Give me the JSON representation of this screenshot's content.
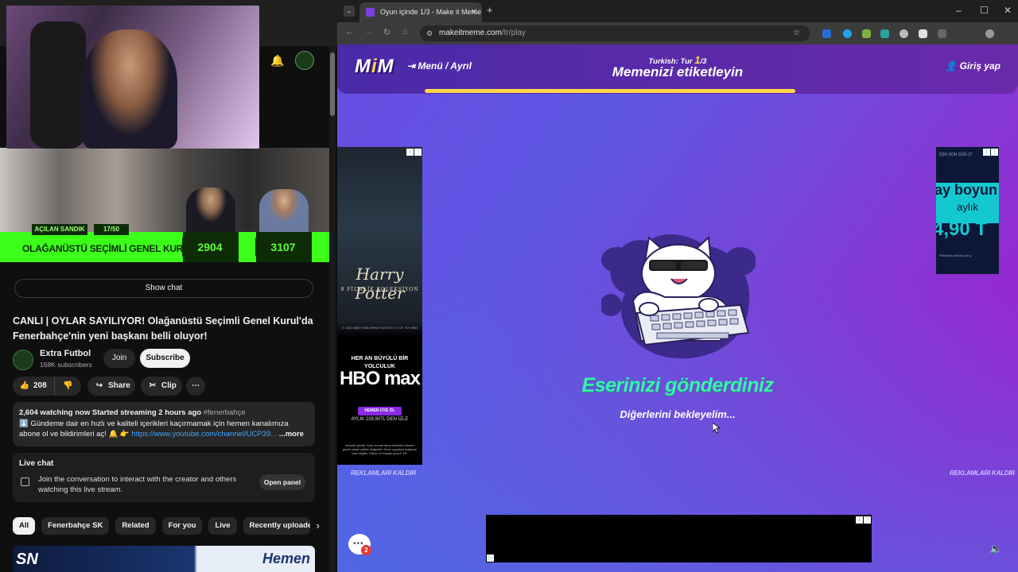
{
  "youtube": {
    "show_chat_label": "Show chat",
    "video_title": "CANLI | OYLAR SAYILIYOR! Olağanüstü Seçimli Genel Kurul'da Fenerbahçe'nin yeni başkanı belli oluyor!",
    "overlay": {
      "tag1": "AÇILAN SANDIK",
      "tag2": "17/50",
      "title": "OLAĞANÜSTÜ SEÇİMLİ GENEL KURUL",
      "count1": "2904",
      "count2": "3107"
    },
    "channel": {
      "name": "Extra Futbol",
      "subscribers": "168K subscribers",
      "join_label": "Join",
      "subscribe_label": "Subscribe"
    },
    "actions": {
      "likes": "208",
      "share_label": "Share",
      "clip_label": "Clip",
      "more_label": "⋯"
    },
    "description": {
      "stats": "2,604 watching now  Started streaming 2 hours ago",
      "hashtag": "#fenerbahçe",
      "text": "⬇️ Gündeme dair en hızlı ve kaliteli içerikleri kaçırmamak için hemen kanalımıza abone ol ve bildirimleri aç! 🔔 👉",
      "link": "https://www.youtube.com/channel/UCP39...",
      "more": "...more"
    },
    "live_chat": {
      "title": "Live chat",
      "text": "Join the conversation to interact with the creator and others watching this live stream.",
      "open_panel_label": "Open panel"
    },
    "chips": [
      "All",
      "Fenerbahçe SK",
      "Related",
      "For you",
      "Live",
      "Recently uploaded"
    ],
    "thumb_logo": "SN",
    "thumb_text": "Hemen"
  },
  "browser": {
    "tab_title": "Oyun içinde 1/3 - Make it Meme",
    "url_host": "makeitmeme.com",
    "url_path": "/tr/play"
  },
  "game": {
    "logo_left": "M",
    "logo_mid": "i",
    "logo_right": "M",
    "menu_label": "Menü / Ayrıl",
    "round_prefix": "Turkish: Tur ",
    "round_num": "1",
    "round_suffix": "/3",
    "round_title": "Memenizi etiketleyin",
    "login_label": "Giriş yap",
    "progress": 0.62,
    "submitted_text": "Eserinizi gönderdiniz",
    "waiting_text": "Diğerlerini bekleyelim...",
    "remove_ads_label": "REKLAMLARI KALDIR",
    "chat_badge": "2",
    "accent": "#39f0b0",
    "progress_color": "#ffd84a"
  },
  "ads": {
    "left": {
      "title": "Harry Potter",
      "subtitle": "8 FİLMLİK KOLEKSİYON",
      "copyright": "© 2025 WBEI PUBLISHING RIGHTS © J.K.R. TM WBEI",
      "headline": "HER AN BÜYÜLÜ BİR YOLCULUK",
      "brand": "HBO max",
      "cta": "HEMEN ÜYE OL",
      "price": "AYLIK 229,90TL'DEN İZLE",
      "fine": "Abonelik gerekir. Fiyat, sonraki fatura tarihinden itibaren geçerli olacak şekilde değişebilir. Örnek uygulama mağazası bazlı değildir. Hüküm ve Koşullar geçerli. 18+"
    },
    "right": {
      "line1": "İÇİN SON GÜN 27",
      "line2": "ay boyun",
      "line3": "aylık",
      "line4": "4,90 T",
      "line5": "Reklamın üstünü için g"
    }
  }
}
